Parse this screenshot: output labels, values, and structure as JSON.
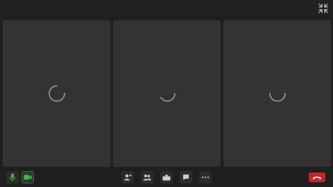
{
  "colors": {
    "background": "#1f1f1f",
    "tile": "#333333",
    "spinner": "#8a8a8a",
    "accent_green": "#4caf50",
    "hangup_red": "#c0282b"
  },
  "participants": [
    {
      "state": "loading"
    },
    {
      "state": "loading"
    },
    {
      "state": "loading"
    }
  ],
  "toolbar": {
    "left": [
      {
        "icon": "microphone-icon",
        "active": false
      },
      {
        "icon": "camera-icon",
        "active": true
      }
    ],
    "center": [
      {
        "icon": "add-person-icon"
      },
      {
        "icon": "participants-icon"
      },
      {
        "icon": "share-screen-icon"
      },
      {
        "icon": "chat-icon"
      },
      {
        "icon": "more-options-icon"
      }
    ],
    "right": [
      {
        "icon": "hang-up-icon"
      }
    ]
  },
  "topbar": {
    "icon": "exit-fullscreen-icon"
  }
}
